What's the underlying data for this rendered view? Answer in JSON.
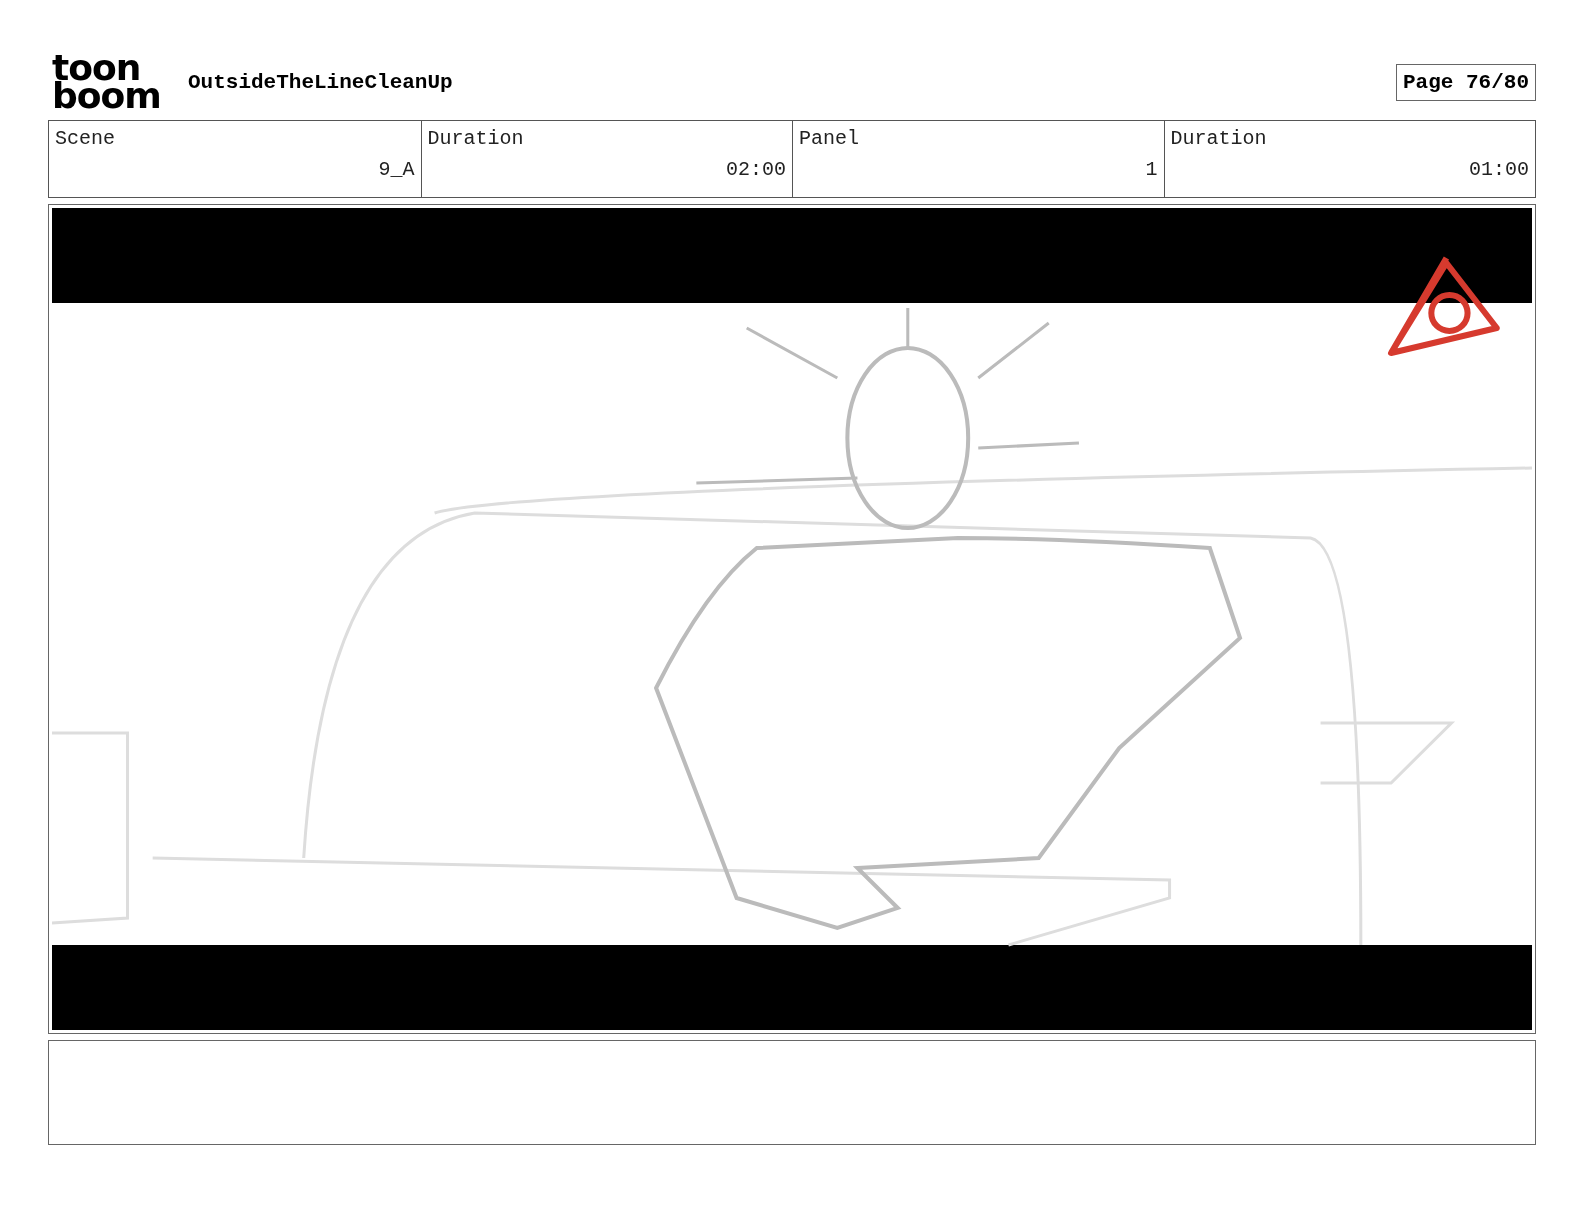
{
  "logo": {
    "lines": [
      "toon",
      "boom"
    ]
  },
  "project_title": "OutsideTheLineCleanUp",
  "page_indicator": "Page 76/80",
  "info_bar": {
    "labels": [
      "Scene",
      "Duration",
      "Panel",
      "Duration"
    ],
    "values": [
      "9_A",
      "02:00",
      "1",
      "01:00"
    ]
  }
}
